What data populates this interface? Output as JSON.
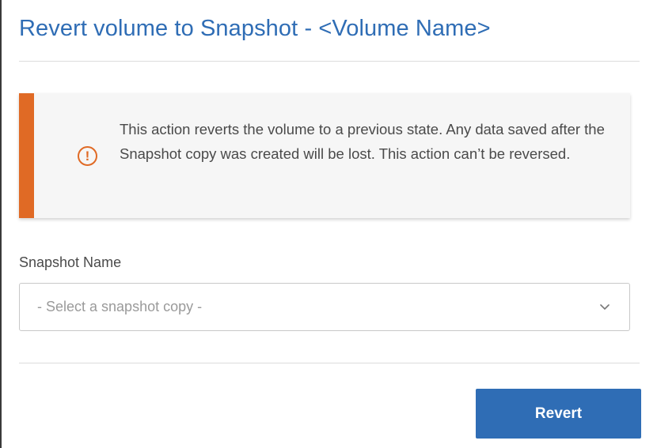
{
  "dialog": {
    "title": "Revert volume to Snapshot - <Volume Name>"
  },
  "warning": {
    "icon": "exclamation-circle-icon",
    "icon_glyph": "!",
    "message": "This action reverts the volume to a previous state. Any data saved after the Snapshot copy was created will be lost. This action can’t be reversed.",
    "accent_color": "#e06a25"
  },
  "snapshot_field": {
    "label": "Snapshot Name",
    "placeholder": "- Select a snapshot copy -",
    "chevron_icon": "chevron-down-icon"
  },
  "actions": {
    "revert_label": "Revert",
    "button_color": "#2f6db5"
  }
}
